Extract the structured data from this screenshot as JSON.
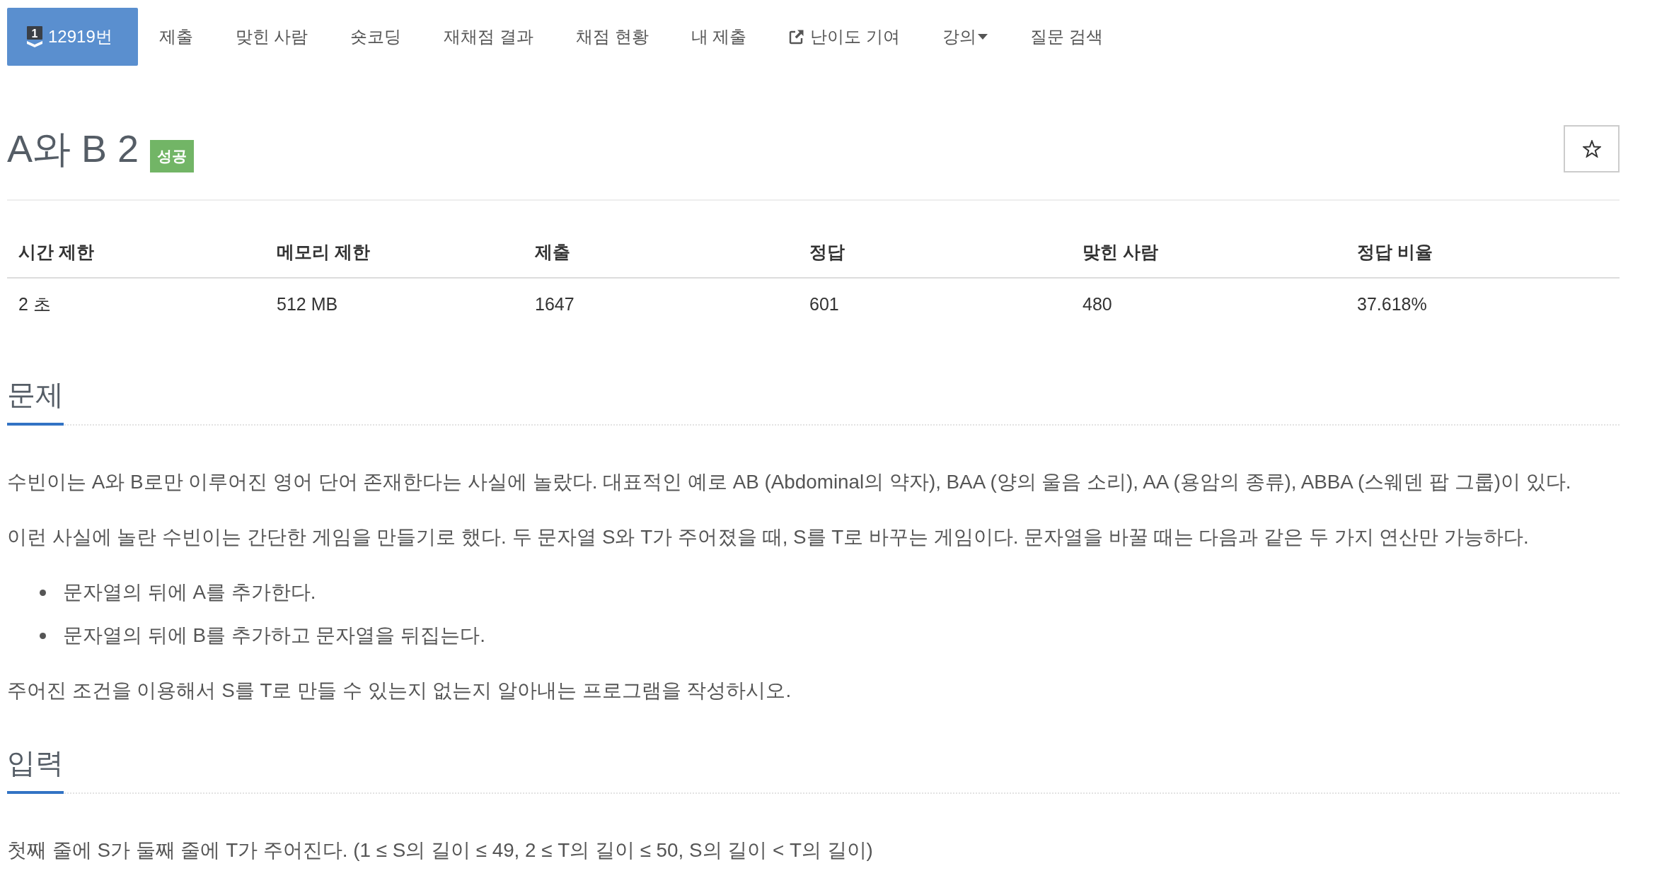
{
  "nav": {
    "tabs": [
      {
        "kind": "number",
        "label": "12919번",
        "selected": true,
        "icon_label": "1"
      },
      {
        "kind": "plain",
        "label": "제출",
        "selected": false
      },
      {
        "kind": "plain",
        "label": "맞힌 사람",
        "selected": false
      },
      {
        "kind": "plain",
        "label": "숏코딩",
        "selected": false
      },
      {
        "kind": "plain",
        "label": "재채점 결과",
        "selected": false
      },
      {
        "kind": "plain",
        "label": "채점 현황",
        "selected": false
      },
      {
        "kind": "plain",
        "label": "내 제출",
        "selected": false
      },
      {
        "kind": "external",
        "label": "난이도 기여",
        "selected": false
      },
      {
        "kind": "dropdown",
        "label": "강의",
        "selected": false
      },
      {
        "kind": "plain",
        "label": "질문 검색",
        "selected": false
      }
    ]
  },
  "problem": {
    "title": "A와 B 2",
    "result_badge": "성공",
    "starred": false
  },
  "info_table": {
    "columns": [
      "시간 제한",
      "메모리 제한",
      "제출",
      "정답",
      "맞힌 사람",
      "정답 비율"
    ],
    "rows": [
      [
        "2 초",
        "512 MB",
        "1647",
        "601",
        "480",
        "37.618%"
      ]
    ]
  },
  "sections": [
    {
      "heading": "문제",
      "blocks": [
        {
          "kind": "paragraph",
          "text": "수빈이는 A와 B로만 이루어진 영어 단어 존재한다는 사실에 놀랐다. 대표적인 예로 AB (Abdominal의 약자), BAA (양의 울음 소리), AA (용암의 종류), ABBA (스웨덴 팝 그룹)이 있다."
        },
        {
          "kind": "paragraph",
          "text": "이런 사실에 놀란 수빈이는 간단한 게임을 만들기로 했다. 두 문자열 S와 T가 주어졌을 때, S를 T로 바꾸는 게임이다. 문자열을 바꿀 때는 다음과 같은 두 가지 연산만 가능하다."
        },
        {
          "kind": "list",
          "items": [
            "문자열의 뒤에 A를 추가한다.",
            "문자열의 뒤에 B를 추가하고 문자열을 뒤집는다."
          ]
        },
        {
          "kind": "paragraph",
          "text": "주어진 조건을 이용해서 S를 T로 만들 수 있는지 없는지 알아내는 프로그램을 작성하시오."
        }
      ]
    },
    {
      "heading": "입력",
      "blocks": [
        {
          "kind": "paragraph",
          "text": "첫째 줄에 S가 둘째 줄에 T가 주어진다. (1 ≤ S의 길이 ≤ 49, 2 ≤ T의 길이 ≤ 50, S의 길이 < T의 길이)"
        }
      ]
    }
  ]
}
